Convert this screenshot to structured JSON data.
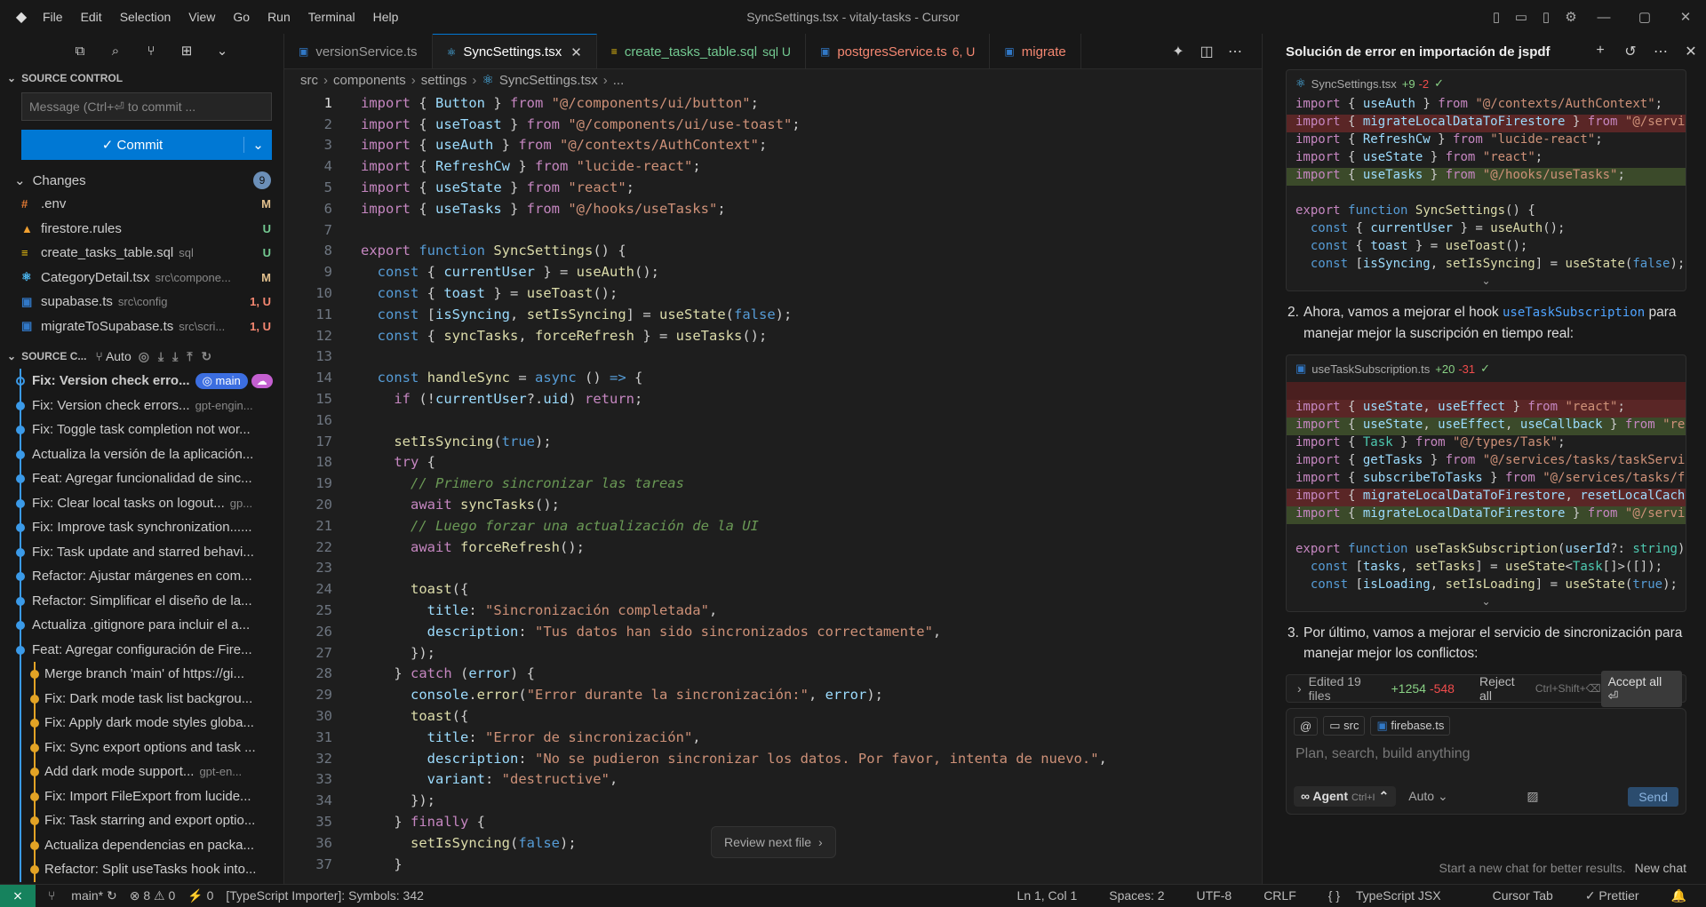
{
  "title": {
    "menu": [
      "File",
      "Edit",
      "Selection",
      "View",
      "Go",
      "Run",
      "Terminal",
      "Help"
    ],
    "window_title": "SyncSettings.tsx - vitaly-tasks - Cursor"
  },
  "sidebar": {
    "header": "SOURCE CONTROL",
    "message_placeholder": "Message (Ctrl+⏎ to commit ...",
    "commit_label": "✓ Commit",
    "changes_label": "Changes",
    "changes_count": "9",
    "files": [
      {
        "name": ".env",
        "dir": "",
        "status": "M",
        "icon": "env-icon",
        "color": "#e37933",
        "scolor": "#e2c08d"
      },
      {
        "name": "firestore.rules",
        "dir": "",
        "status": "U",
        "icon": "firebase-icon",
        "color": "#f0a030",
        "scolor": "#73c991"
      },
      {
        "name": "create_tasks_table.sql",
        "dir": "sql",
        "status": "U",
        "icon": "database-icon",
        "color": "#f1c40f",
        "scolor": "#73c991"
      },
      {
        "name": "CategoryDetail.tsx",
        "dir": "src\\compone...",
        "status": "M",
        "icon": "react-icon",
        "color": "#4fc1ff",
        "scolor": "#e2c08d"
      },
      {
        "name": "supabase.ts",
        "dir": "src\\config",
        "status": "1, U",
        "icon": "ts-icon",
        "color": "#3178c6",
        "scolor": "#f48771"
      },
      {
        "name": "migrateToSupabase.ts",
        "dir": "src\\scri...",
        "status": "1, U",
        "icon": "ts-icon",
        "color": "#3178c6",
        "scolor": "#f48771"
      }
    ],
    "graph_header": "SOURCE C...",
    "graph_auto": "Auto",
    "commits": [
      {
        "msg": "Fix: Version check erro...",
        "author": "",
        "tag": "main",
        "bold": true
      },
      {
        "msg": "Fix: Version check errors...",
        "author": "gpt-engin..."
      },
      {
        "msg": "Fix: Toggle task completion not wor...",
        "author": ""
      },
      {
        "msg": "Actualiza la versión de la aplicación...",
        "author": ""
      },
      {
        "msg": "Feat: Agregar funcionalidad de sinc...",
        "author": ""
      },
      {
        "msg": "Fix: Clear local tasks on logout...",
        "author": "gp..."
      },
      {
        "msg": "Fix: Improve task synchronization......",
        "author": ""
      },
      {
        "msg": "Fix: Task update and starred behavi...",
        "author": ""
      },
      {
        "msg": "Refactor: Ajustar márgenes en com...",
        "author": ""
      },
      {
        "msg": "Refactor: Simplificar el diseño de la...",
        "author": ""
      },
      {
        "msg": "Actualiza .gitignore para incluir el a...",
        "author": ""
      },
      {
        "msg": "Feat: Agregar configuración de Fire...",
        "author": ""
      },
      {
        "msg": "Merge branch 'main' of https://gi...",
        "author": "",
        "sub": true
      },
      {
        "msg": "Fix: Dark mode task list backgrou...",
        "author": "",
        "sub": true
      },
      {
        "msg": "Fix: Apply dark mode styles globa...",
        "author": "",
        "sub": true
      },
      {
        "msg": "Fix: Sync export options and task ...",
        "author": "",
        "sub": true
      },
      {
        "msg": "Add dark mode support...",
        "author": "gpt-en...",
        "sub": true
      },
      {
        "msg": "Fix: Import FileExport from lucide...",
        "author": "",
        "sub": true
      },
      {
        "msg": "Fix: Task starring and export optio...",
        "author": "",
        "sub": true
      },
      {
        "msg": "Actualiza dependencias en packa...",
        "author": "",
        "sub": true
      },
      {
        "msg": "Refactor: Split useTasks hook into...",
        "author": "",
        "sub": true
      }
    ]
  },
  "tabs": [
    {
      "label": "versionService.ts",
      "icon": "ts-icon",
      "sfx": "",
      "color": "#999"
    },
    {
      "label": "SyncSettings.tsx",
      "icon": "react-icon",
      "sfx": "",
      "color": "#fff",
      "active": true
    },
    {
      "label": "create_tasks_table.sql",
      "icon": "database-icon",
      "sfx": "sql U",
      "color": "#73c991"
    },
    {
      "label": "postgresService.ts",
      "icon": "ts-icon",
      "sfx": "6, U",
      "color": "#f48771"
    },
    {
      "label": "migrate",
      "icon": "ts-icon",
      "sfx": "",
      "color": "#f48771"
    }
  ],
  "breadcrumb": [
    "src",
    "components",
    "settings",
    "SyncSettings.tsx",
    "..."
  ],
  "code_lines": [
    "1",
    "2",
    "3",
    "4",
    "5",
    "6",
    "7",
    "8",
    "9",
    "10",
    "11",
    "12",
    "13",
    "14",
    "15",
    "16",
    "17",
    "18",
    "19",
    "20",
    "21",
    "22",
    "23",
    "24",
    "25",
    "26",
    "27",
    "28",
    "29",
    "30",
    "31",
    "32",
    "33",
    "34",
    "35",
    "36",
    "37"
  ],
  "review_label": "Review next file",
  "chat": {
    "title": "Solución de error en importación de jspdf",
    "block1": {
      "file": "SyncSettings.tsx",
      "add": "+9",
      "del": "-2"
    },
    "step2": "Ahora, vamos a mejorar el hook",
    "step2_code": "useTaskSubscription",
    "step2_tail": "para manejar mejor la suscripción en tiempo real:",
    "block2": {
      "file": "useTaskSubscription.ts",
      "add": "+20",
      "del": "-31"
    },
    "step3": "Por último, vamos a mejorar el servicio de sincronización para manejar mejor los conflictos:",
    "edited": "Edited 19 files",
    "edited_add": "+1254",
    "edited_del": "-548",
    "reject": "Reject all",
    "reject_kb": "Ctrl+Shift+⌫",
    "accept": "Accept all ⏎",
    "chip1": "src",
    "chip2": "firebase.ts",
    "placeholder": "Plan, search, build anything",
    "agent": "Agent",
    "agent_kb": "Ctrl+I",
    "auto": "Auto",
    "send": "Send",
    "footer": "Start a new chat for better results.",
    "new_chat": "New chat"
  },
  "status": {
    "branch": "main*",
    "errors": "⊗ 8 ⚠ 0",
    "ports": "⚡ 0",
    "importer": "[TypeScript Importer]: Symbols: 342",
    "position": "Ln 1, Col 1",
    "spaces": "Spaces: 2",
    "encoding": "UTF-8",
    "eol": "CRLF",
    "lang": "TypeScript JSX",
    "tab": "Cursor Tab",
    "prettier": "✓ Prettier"
  }
}
